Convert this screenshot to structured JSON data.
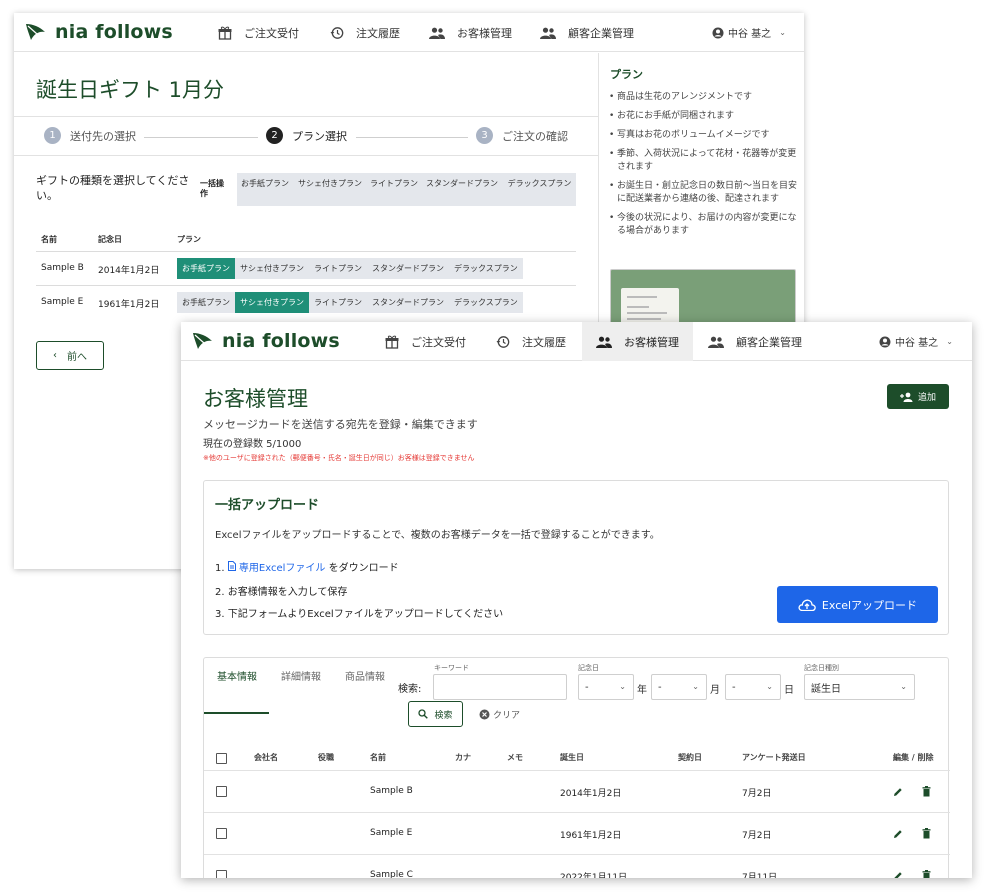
{
  "brand": {
    "name": "nia follows",
    "color": "#1d4d2a"
  },
  "nav": {
    "items": [
      {
        "label": "ご注文受付",
        "icon": "gift-icon"
      },
      {
        "label": "注文履歴",
        "icon": "history-icon"
      },
      {
        "label": "お客様管理",
        "icon": "people-icon"
      },
      {
        "label": "顧客企業管理",
        "icon": "people-icon"
      }
    ],
    "user": "中谷 基之"
  },
  "order": {
    "title": "誕生日ギフト 1月分",
    "steps": [
      {
        "num": "1",
        "label": "送付先の選択"
      },
      {
        "num": "2",
        "label": "プラン選択"
      },
      {
        "num": "3",
        "label": "ご注文の確認"
      }
    ],
    "prompt": "ギフトの種類を選択してください。",
    "bulk_label": "一括操作",
    "bulk_plans": [
      "お手紙プラン",
      "サシェ付きプラン",
      "ライトプラン",
      "スタンダードプラン",
      "デラックスプラン"
    ],
    "table_headers": {
      "name": "名前",
      "date": "記念日",
      "plan": "プラン"
    },
    "rows": [
      {
        "name": "Sample B",
        "date": "2014年1月2日",
        "selected": "お手紙プラン"
      },
      {
        "name": "Sample E",
        "date": "1961年1月2日",
        "selected": "サシェ付きプラン"
      }
    ],
    "row_plans": [
      "お手紙プラン",
      "サシェ付きプラン",
      "ライトプラン",
      "スタンダードプラン",
      "デラックスプラン"
    ],
    "prev_label": "前へ",
    "side": {
      "title": "プラン",
      "notes": [
        "商品は生花のアレンジメントです",
        "お花にお手紙が同梱されます",
        "写真はお花のボリュームイメージです",
        "季節、入荷状況によって花材・花器等が変更されます",
        "お誕生日・創立記念日の数日前〜当日を目安に配送業者から連絡の後、配達されます",
        "今後の状況により、お届けの内容が変更になる場合があります"
      ]
    }
  },
  "customers": {
    "title": "お客様管理",
    "add_label": "追加",
    "description": "メッセージカードを送信する宛先を登録・編集できます",
    "count": "現在の登録数 5/1000",
    "warning": "※他のユーザに登録された（郵便番号・氏名・誕生日が同じ）お客様は登録できません",
    "upload": {
      "title": "一括アップロード",
      "description": "Excelファイルをアップロードすることで、複数のお客様データを一括で登録することができます。",
      "step1_prefix": "1.",
      "step1_link": "専用Excelファイル",
      "step1_suffix": "をダウンロード",
      "step2": "2. お客様情報を入力して保存",
      "step3": "3. 下記フォームよりExcelファイルをアップロードしてください",
      "button": "Excelアップロード"
    },
    "tabs": [
      "基本情報",
      "詳細情報",
      "商品情報"
    ],
    "search": {
      "label": "検索:",
      "keyword_label": "キーワード",
      "keyword_value": "",
      "date_label": "記念日",
      "month_value": "-",
      "year_unit": "年",
      "day_value": "-",
      "month_unit": "月",
      "dd_value": "-",
      "day_unit": "日",
      "type_label": "記念日種別",
      "type_value": "誕生日",
      "search_button": "検索",
      "clear_button": "クリア"
    },
    "columns": [
      "会社名",
      "役職",
      "名前",
      "カナ",
      "メモ",
      "誕生日",
      "契約日",
      "アンケート発送日",
      "編集 / 削除"
    ],
    "rows": [
      {
        "name": "Sample B",
        "birthday": "2014年1月2日",
        "survey": "7月2日"
      },
      {
        "name": "Sample E",
        "birthday": "1961年1月2日",
        "survey": "7月2日"
      },
      {
        "name": "Sample C",
        "birthday": "2022年1月11日",
        "survey": "7月11日"
      }
    ],
    "colors": {
      "primary": "#1d4d2a",
      "accent_blue": "#1e66e8",
      "selected_plan": "#1f8f78",
      "warning": "#e53935"
    }
  }
}
